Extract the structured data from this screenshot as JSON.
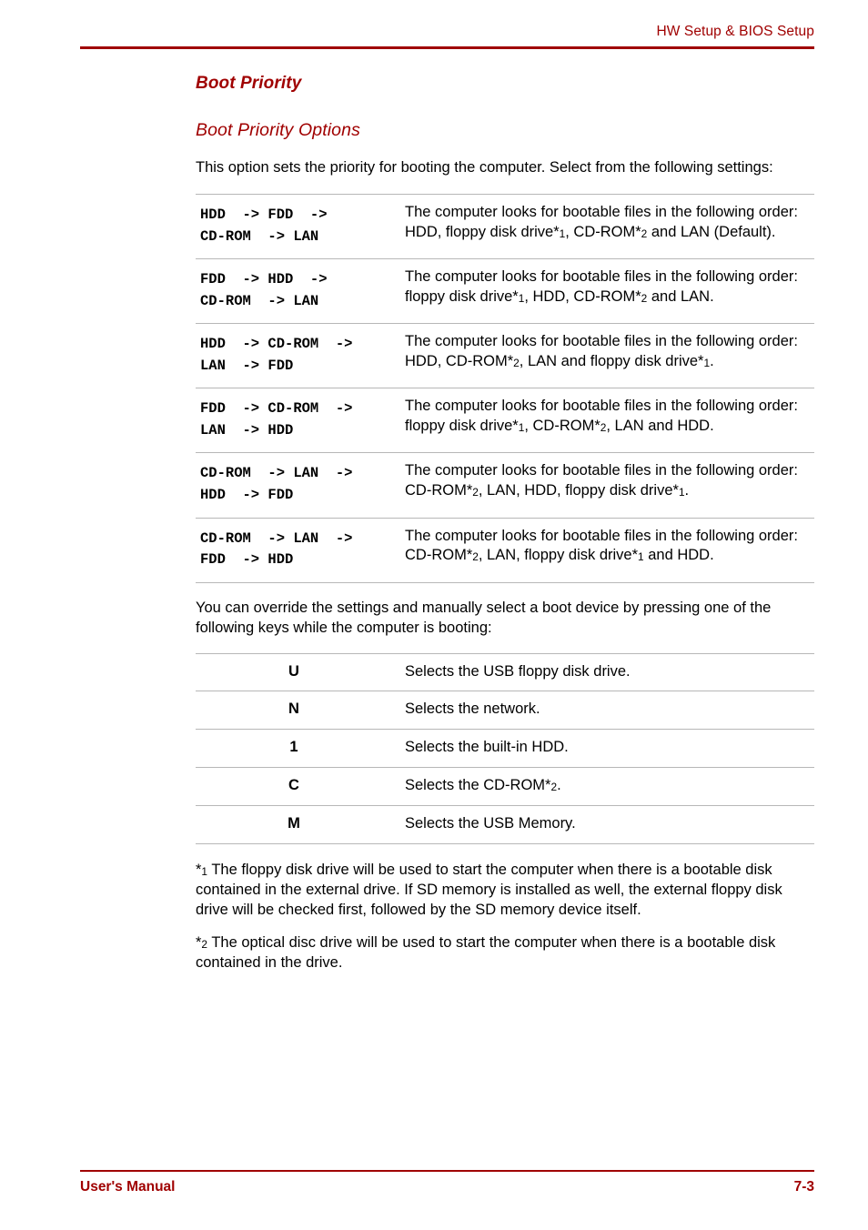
{
  "header": {
    "text": "HW Setup & BIOS Setup",
    "accent_color": "#A00000"
  },
  "section": {
    "title": "Boot Priority",
    "subtitle": "Boot Priority Options",
    "intro": "This option sets the priority for booting the computer. Select from the following settings:",
    "override_paragraph": "You can override the settings and manually select a boot device by pressing one of the following keys while the computer is booting:"
  },
  "boot_table": {
    "rows": [
      {
        "option_line1": "HDD  -> FDD  ->",
        "option_line2": "CD-ROM  -> LAN",
        "desc_a": "The computer looks for bootable files in the following order: HDD, floppy disk drive*",
        "fn_a": "1",
        "desc_b": ", CD-ROM*",
        "fn_b": "2",
        "desc_c": " and LAN (Default)."
      },
      {
        "option_line1": "FDD  -> HDD  ->",
        "option_line2": "CD-ROM  -> LAN",
        "desc_a": "The computer looks for bootable files in the following order: floppy disk drive*",
        "fn_a": "1",
        "desc_b": ", HDD, CD-ROM*",
        "fn_b": "2",
        "desc_c": " and LAN."
      },
      {
        "option_line1": "HDD  -> CD-ROM  ->",
        "option_line2": "LAN  -> FDD",
        "desc_a": "The computer looks for bootable files in the following order: HDD, CD-ROM*",
        "fn_a": "2",
        "desc_b": ", LAN and floppy disk drive*",
        "fn_b": "1",
        "desc_c": "."
      },
      {
        "option_line1": "FDD  -> CD-ROM  ->",
        "option_line2": "LAN  -> HDD",
        "desc_a": "The computer looks for bootable files in the following order: floppy disk drive*",
        "fn_a": "1",
        "desc_b": ", CD-ROM*",
        "fn_b": "2",
        "desc_c": ", LAN and HDD."
      },
      {
        "option_line1": "CD-ROM  -> LAN  ->",
        "option_line2": "HDD  -> FDD",
        "desc_a": "The computer looks for bootable files in the following order: CD-ROM*",
        "fn_a": "2",
        "desc_b": ", LAN, HDD, floppy disk drive*",
        "fn_b": "1",
        "desc_c": "."
      },
      {
        "option_line1": "CD-ROM  -> LAN  ->",
        "option_line2": "FDD  -> HDD",
        "desc_a": "The computer looks for bootable files in the following order: CD-ROM*",
        "fn_a": "2",
        "desc_b": ", LAN, floppy disk drive*",
        "fn_b": "1",
        "desc_c": " and HDD."
      }
    ]
  },
  "keys_table": {
    "rows": [
      {
        "key": "U",
        "desc_a": "Selects the USB floppy disk drive.",
        "fn": "",
        "desc_b": ""
      },
      {
        "key": "N",
        "desc_a": "Selects the network.",
        "fn": "",
        "desc_b": ""
      },
      {
        "key": "1",
        "desc_a": "Selects the built-in HDD.",
        "fn": "",
        "desc_b": ""
      },
      {
        "key": "C",
        "desc_a": "Selects the CD-ROM*",
        "fn": "2",
        "desc_b": "."
      },
      {
        "key": "M",
        "desc_a": "Selects the USB Memory.",
        "fn": "",
        "desc_b": ""
      }
    ]
  },
  "footnotes": [
    {
      "marker_star": "*",
      "marker_num": "1",
      "text": " The floppy disk drive will be used to start the computer when there is a bootable disk contained in the external drive. If SD memory is installed as well, the external floppy disk drive will be checked first, followed by the SD memory device itself."
    },
    {
      "marker_star": "*",
      "marker_num": "2",
      "text": " The optical disc drive will be used to start the computer when there is a bootable disk contained in the drive."
    }
  ],
  "footer": {
    "left": "User's Manual",
    "right": "7-3"
  }
}
